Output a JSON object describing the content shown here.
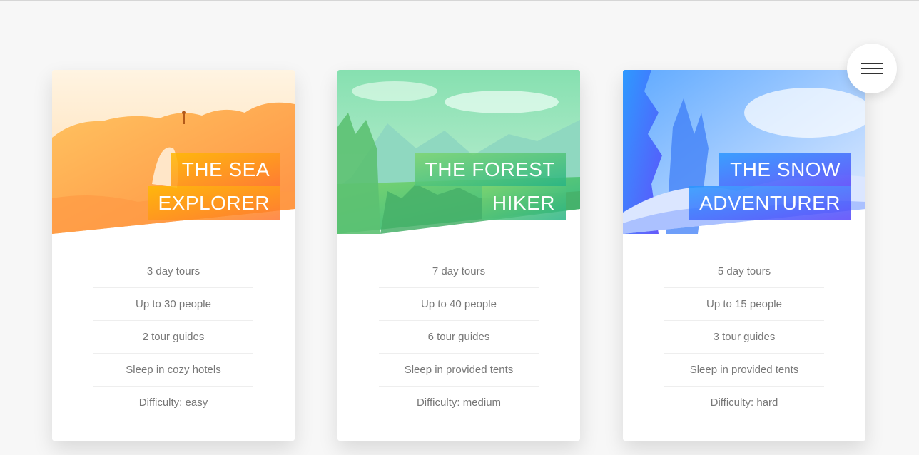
{
  "menu": {
    "icon": "hamburger-menu-icon"
  },
  "cards": [
    {
      "heading": [
        "The Sea",
        "Explorer"
      ],
      "picture": "sea-arch-photo",
      "details": [
        "3 day tours",
        "Up to 30 people",
        "2 tour guides",
        "Sleep in cozy hotels",
        "Difficulty: easy"
      ],
      "colors": {
        "start": "#ffb900",
        "end": "#ff7730"
      }
    },
    {
      "heading": [
        "The Forest",
        "Hiker"
      ],
      "picture": "forest-mountains-photo",
      "details": [
        "7 day tours",
        "Up to 40 people",
        "6 tour guides",
        "Sleep in provided tents",
        "Difficulty: medium"
      ],
      "colors": {
        "start": "#7ed56f",
        "end": "#28b485"
      }
    },
    {
      "heading": [
        "The Snow",
        "Adventurer"
      ],
      "picture": "snowy-forest-photo",
      "details": [
        "5 day tours",
        "Up to 15 people",
        "3 tour guides",
        "Sleep in provided tents",
        "Difficulty: hard"
      ],
      "colors": {
        "start": "#2998ff",
        "end": "#5643fa"
      }
    }
  ]
}
